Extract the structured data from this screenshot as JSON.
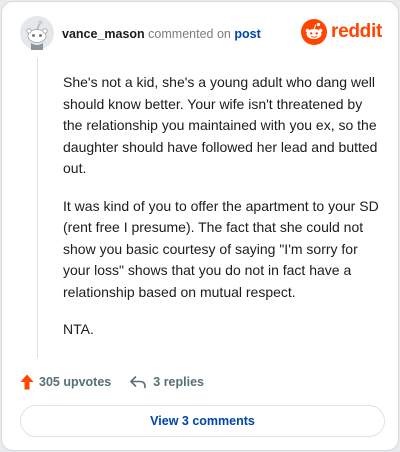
{
  "header": {
    "author": "vance_mason",
    "verb": "commented on",
    "post_link": "post",
    "brand_name": "reddit",
    "brand_color": "#ff4500"
  },
  "comment": {
    "paragraphs": [
      "She's not a kid, she's a young adult who dang well should know better. Your wife isn't threatened by the relationship you maintained with you ex, so the daughter should have followed her lead and butted out.",
      "It was kind of you to offer the apartment to your SD (rent free I presume). The fact that she could not show you basic courtesy of saying \"I'm sorry for your loss\" shows that you do not in fact have a relationship based on mutual respect.",
      "NTA."
    ]
  },
  "actions": {
    "upvotes": "305 upvotes",
    "upvote_icon": "upvote-arrow-icon",
    "upvote_color": "#ff4500",
    "replies": "3 replies",
    "reply_icon": "reply-arrow-icon"
  },
  "footer": {
    "view_comments": "View 3 comments"
  }
}
